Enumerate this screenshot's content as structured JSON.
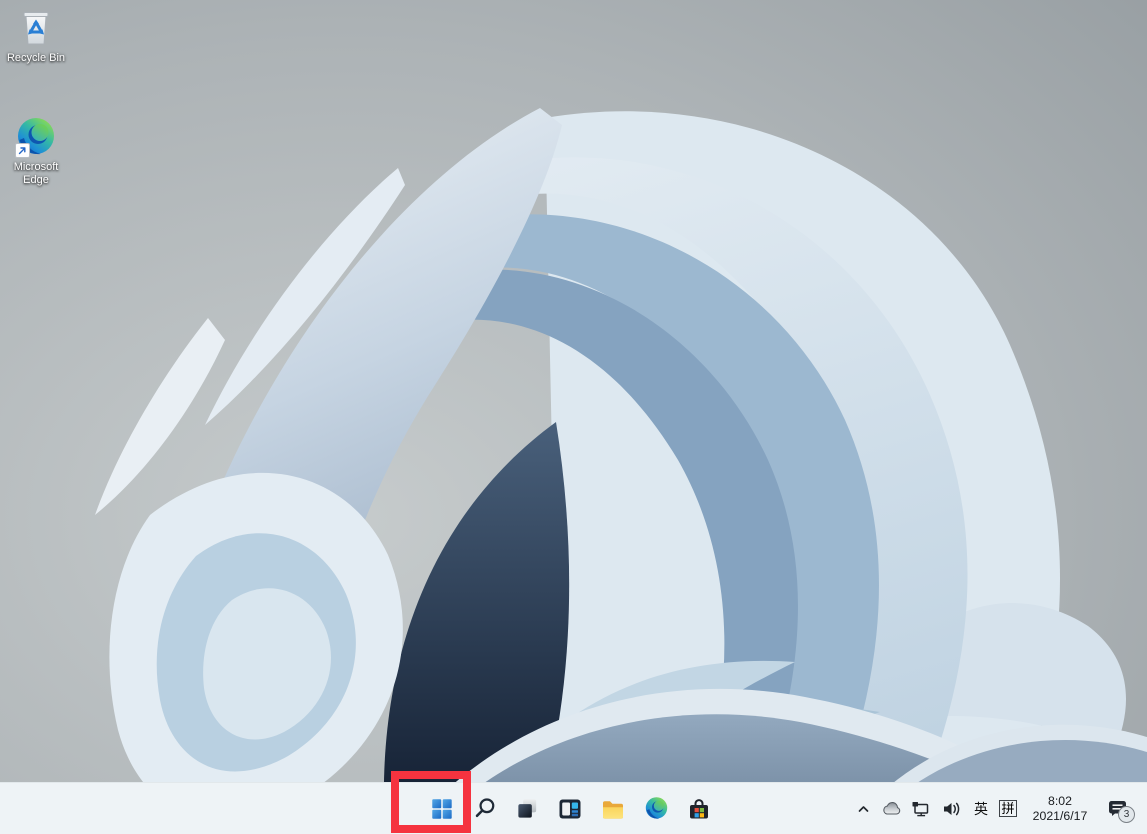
{
  "desktop": {
    "icons": [
      {
        "name": "recycle-bin",
        "label": "Recycle Bin"
      },
      {
        "name": "microsoft-edge-shortcut",
        "label": "Microsoft Edge"
      }
    ]
  },
  "taskbar": {
    "buttons": [
      {
        "icon": "start-icon"
      },
      {
        "icon": "search-icon"
      },
      {
        "icon": "task-view-icon"
      },
      {
        "icon": "widgets-icon"
      },
      {
        "icon": "file-explorer-icon"
      },
      {
        "icon": "edge-icon"
      },
      {
        "icon": "microsoft-store-icon"
      }
    ],
    "tray": {
      "icons": [
        "chevron-up-icon",
        "onedrive-cloud-icon",
        "network-icon",
        "volume-icon"
      ],
      "ime_language": "英",
      "ime_mode": "拼",
      "time": "8:02",
      "date": "2021/6/17",
      "notification_count": "3"
    }
  },
  "annotation": {
    "shape": "rectangle-highlight",
    "target": "start-button",
    "color": "#f5333f"
  },
  "colors": {
    "taskbar_bg": "#eef3f6",
    "start_blue": "#2e86d6",
    "wallpaper_gray": "#9aa1a5"
  }
}
